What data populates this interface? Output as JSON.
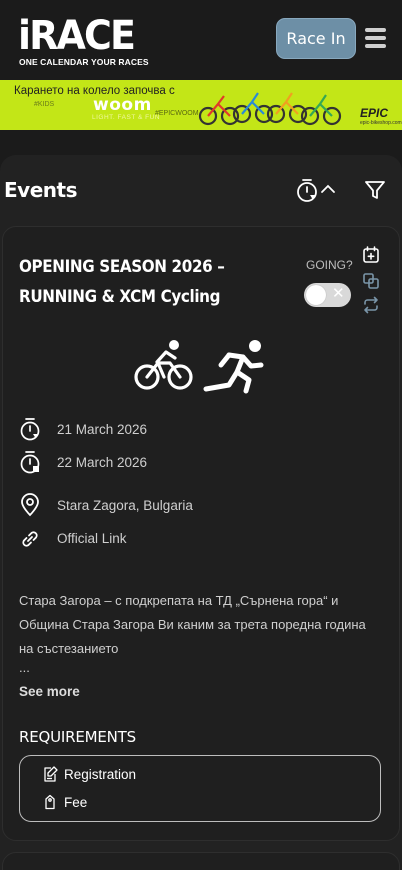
{
  "header": {
    "logo_text": "iRACE",
    "logo_tagline": "ONE CALENDAR YOUR RACES",
    "race_in_label": "Race In",
    "menu_icon": "hamburger-menu-icon"
  },
  "banner": {
    "headline": "Карането на колело започва с",
    "kids_tag": "#KIDS",
    "brand": "woom",
    "brand_tagline": "LIGHT. FAST & FUN",
    "hashtag": "#EPICWOOM",
    "partner": "EPIC",
    "partner_url_text": "epic-bikeshop.com"
  },
  "events": {
    "title": "Events",
    "sort_icon": "timer-sort-icon",
    "filter_icon": "filter-icon"
  },
  "event": {
    "title": "OPENING SEASON 2026 – RUNNING & XCM Cycling",
    "going_label": "GOING?",
    "going": false,
    "sports": [
      "cycling",
      "running"
    ],
    "start_date": "21 March 2026",
    "end_date": "22 March 2026",
    "location": "Stara Zagora, Bulgaria",
    "link_label": "Official Link",
    "description": "Стара Загора – с подкрепата на ТД „Сърнена гора“ и Община Стара Загора Ви каним за трета поредна година на състезанието",
    "ellipsis": "...",
    "see_more": "See more",
    "requirements_title": "REQUIREMENTS",
    "requirements": [
      {
        "icon": "registration-icon",
        "label": "Registration"
      },
      {
        "icon": "fee-tag-icon",
        "label": "Fee"
      }
    ]
  },
  "colors": {
    "background": "#1b1b1b",
    "race_in_button": "#6d8fa6",
    "banner": "#c3e617",
    "card": "#1f1f1f",
    "accent_icons": "#7a95a8"
  }
}
